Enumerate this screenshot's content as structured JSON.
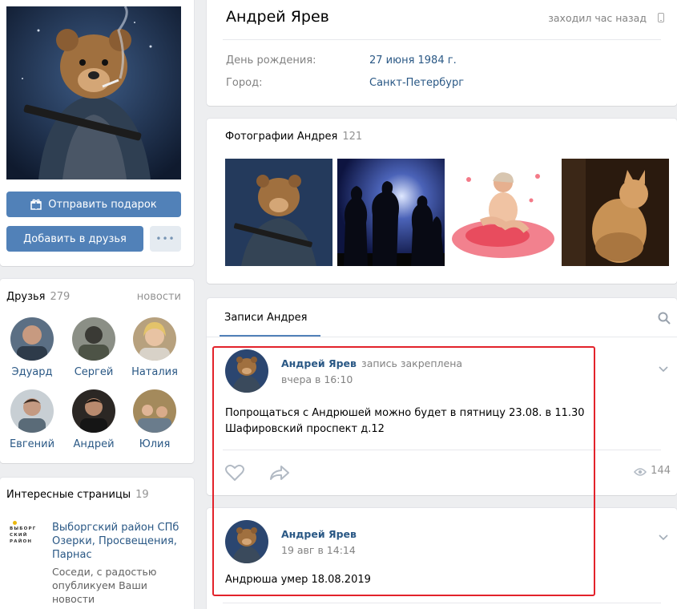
{
  "profile": {
    "name": "Андрей Ярев",
    "status": "заходил час назад",
    "birthday_label": "День рождения:",
    "birthday_value": "27 июня 1984 г.",
    "city_label": "Город:",
    "city_value": "Санкт-Петербург"
  },
  "actions": {
    "gift": "Отправить подарок",
    "add_friend": "Добавить в друзья",
    "more": "•••"
  },
  "friends": {
    "title": "Друзья",
    "count": "279",
    "news": "новости",
    "items": [
      {
        "name": "Эдуард",
        "color": "#5b6f84"
      },
      {
        "name": "Сергей",
        "color": "#6f7263"
      },
      {
        "name": "Наталия",
        "color": "#b59a7a"
      },
      {
        "name": "Евгений",
        "color": "#8c9aa4"
      },
      {
        "name": "Андрей",
        "color": "#3a3633"
      },
      {
        "name": "Юлия",
        "color": "#a88c5e"
      }
    ]
  },
  "pages": {
    "title": "Интересные страницы",
    "count": "19",
    "logo_text": "ВЫБОРГ СКИЙ РАЙОН",
    "item_title": "Выборгский район СПб Озерки, Просвещения, Парнас",
    "item_desc": "Соседи, с радостью опубликуем Ваши новости"
  },
  "photos": {
    "title": "Фотографии Андрея",
    "count": "121"
  },
  "wall": {
    "tab": "Записи Андрея",
    "posts": [
      {
        "author": "Андрей Ярев",
        "pinned": "запись закреплена",
        "time": "вчера в 16:10",
        "text_line1": "Попрощаться с Андрюшей можно будет в пятницу 23.08. в 11.30",
        "text_line2": "Шафировский проспект д.12",
        "views": "144"
      },
      {
        "author": "Андрей Ярев",
        "time": "19 авг в 14:14",
        "text_line1": "Андрюша умер 18.08.2019"
      }
    ]
  }
}
